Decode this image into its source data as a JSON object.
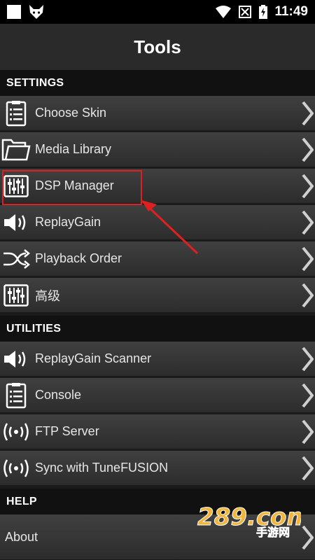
{
  "status_bar": {
    "time": "11:49",
    "icons": [
      "square-icon",
      "fox-icon",
      "wifi-icon",
      "no-sim-icon",
      "battery-charging-icon"
    ]
  },
  "header": {
    "title": "Tools"
  },
  "sections": {
    "settings": "SETTINGS",
    "utilities": "UTILITIES",
    "help": "HELP"
  },
  "settings_items": [
    {
      "label": "Choose Skin",
      "icon": "clipboard-list-icon"
    },
    {
      "label": "Media Library",
      "icon": "folder-icon"
    },
    {
      "label": "DSP Manager",
      "icon": "equalizer-icon"
    },
    {
      "label": "ReplayGain",
      "icon": "speaker-icon"
    },
    {
      "label": "Playback Order",
      "icon": "shuffle-icon"
    },
    {
      "label": "高级",
      "icon": "equalizer-icon"
    }
  ],
  "utilities_items": [
    {
      "label": "ReplayGain Scanner",
      "icon": "speaker-icon"
    },
    {
      "label": "Console",
      "icon": "clipboard-list-icon"
    },
    {
      "label": "FTP Server",
      "icon": "broadcast-icon"
    },
    {
      "label": "Sync with TuneFUSION",
      "icon": "broadcast-icon"
    }
  ],
  "help_items": [
    {
      "label": "About",
      "icon": ""
    }
  ],
  "annotation": {
    "color": "#e02020"
  },
  "watermark": {
    "text": "289.com",
    "subtext": "手游网"
  }
}
